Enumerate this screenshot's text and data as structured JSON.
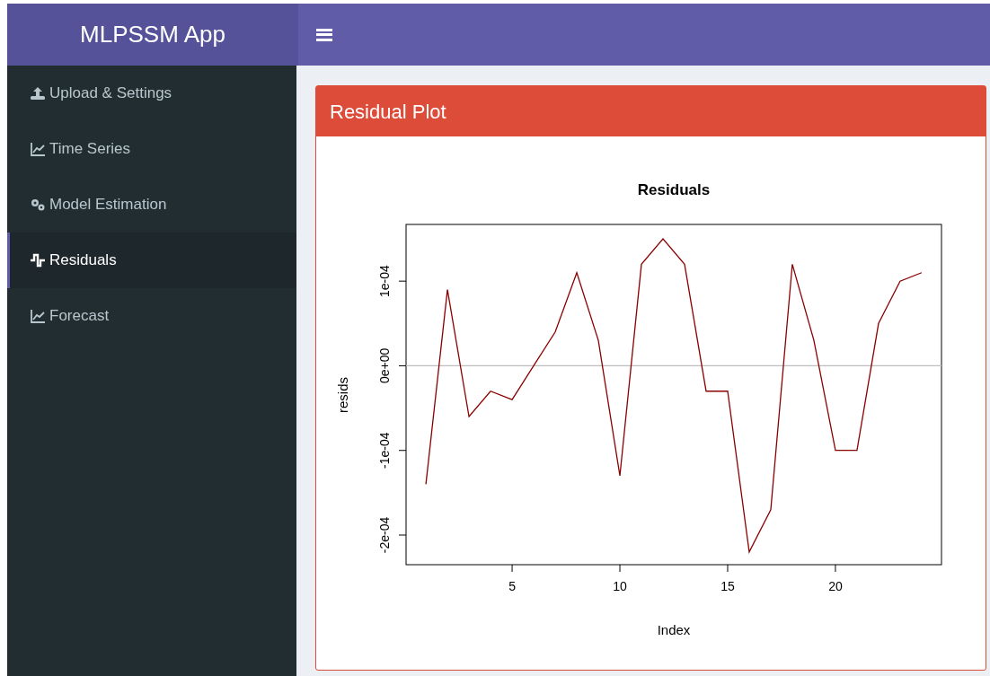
{
  "header": {
    "title": "MLPSSM App"
  },
  "sidebar": {
    "items": [
      {
        "label": "Upload & Settings",
        "selected": false
      },
      {
        "label": "Time Series",
        "selected": false
      },
      {
        "label": "Model Estimation",
        "selected": false
      },
      {
        "label": "Residuals",
        "selected": true
      },
      {
        "label": "Forecast",
        "selected": false
      }
    ]
  },
  "card": {
    "title": "Residual Plot",
    "chart_data": {
      "type": "line",
      "title": "Residuals",
      "xlabel": "Index",
      "ylabel": "resids",
      "x": [
        1,
        2,
        3,
        4,
        5,
        6,
        7,
        8,
        9,
        10,
        11,
        12,
        13,
        14,
        15,
        16,
        17,
        18,
        19,
        20,
        21,
        22,
        23,
        24
      ],
      "series": [
        {
          "color": "#8b0000",
          "values": [
            -0.00014,
            9e-05,
            -6e-05,
            -3e-05,
            -4e-05,
            0,
            4e-05,
            0.00011,
            3e-05,
            -0.00013,
            0.00012,
            0.00015,
            0.00012,
            -3e-05,
            -3e-05,
            -0.00022,
            -0.00017,
            0.00012,
            3e-05,
            -0.0001,
            -0.0001,
            5e-05,
            0.0001,
            0.00011
          ]
        }
      ],
      "xlim": [
        0.08,
        24.92
      ],
      "ylim": [
        -0.000235,
        0.000167
      ],
      "xticks": [
        5,
        10,
        15,
        20
      ],
      "yticks": [
        {
          "value": -0.0002,
          "label": "-2e-04"
        },
        {
          "value": -0.0001,
          "label": "-1e-04"
        },
        {
          "value": 0,
          "label": "0e+00"
        },
        {
          "value": 0.0001,
          "label": "1e-04"
        }
      ]
    }
  }
}
